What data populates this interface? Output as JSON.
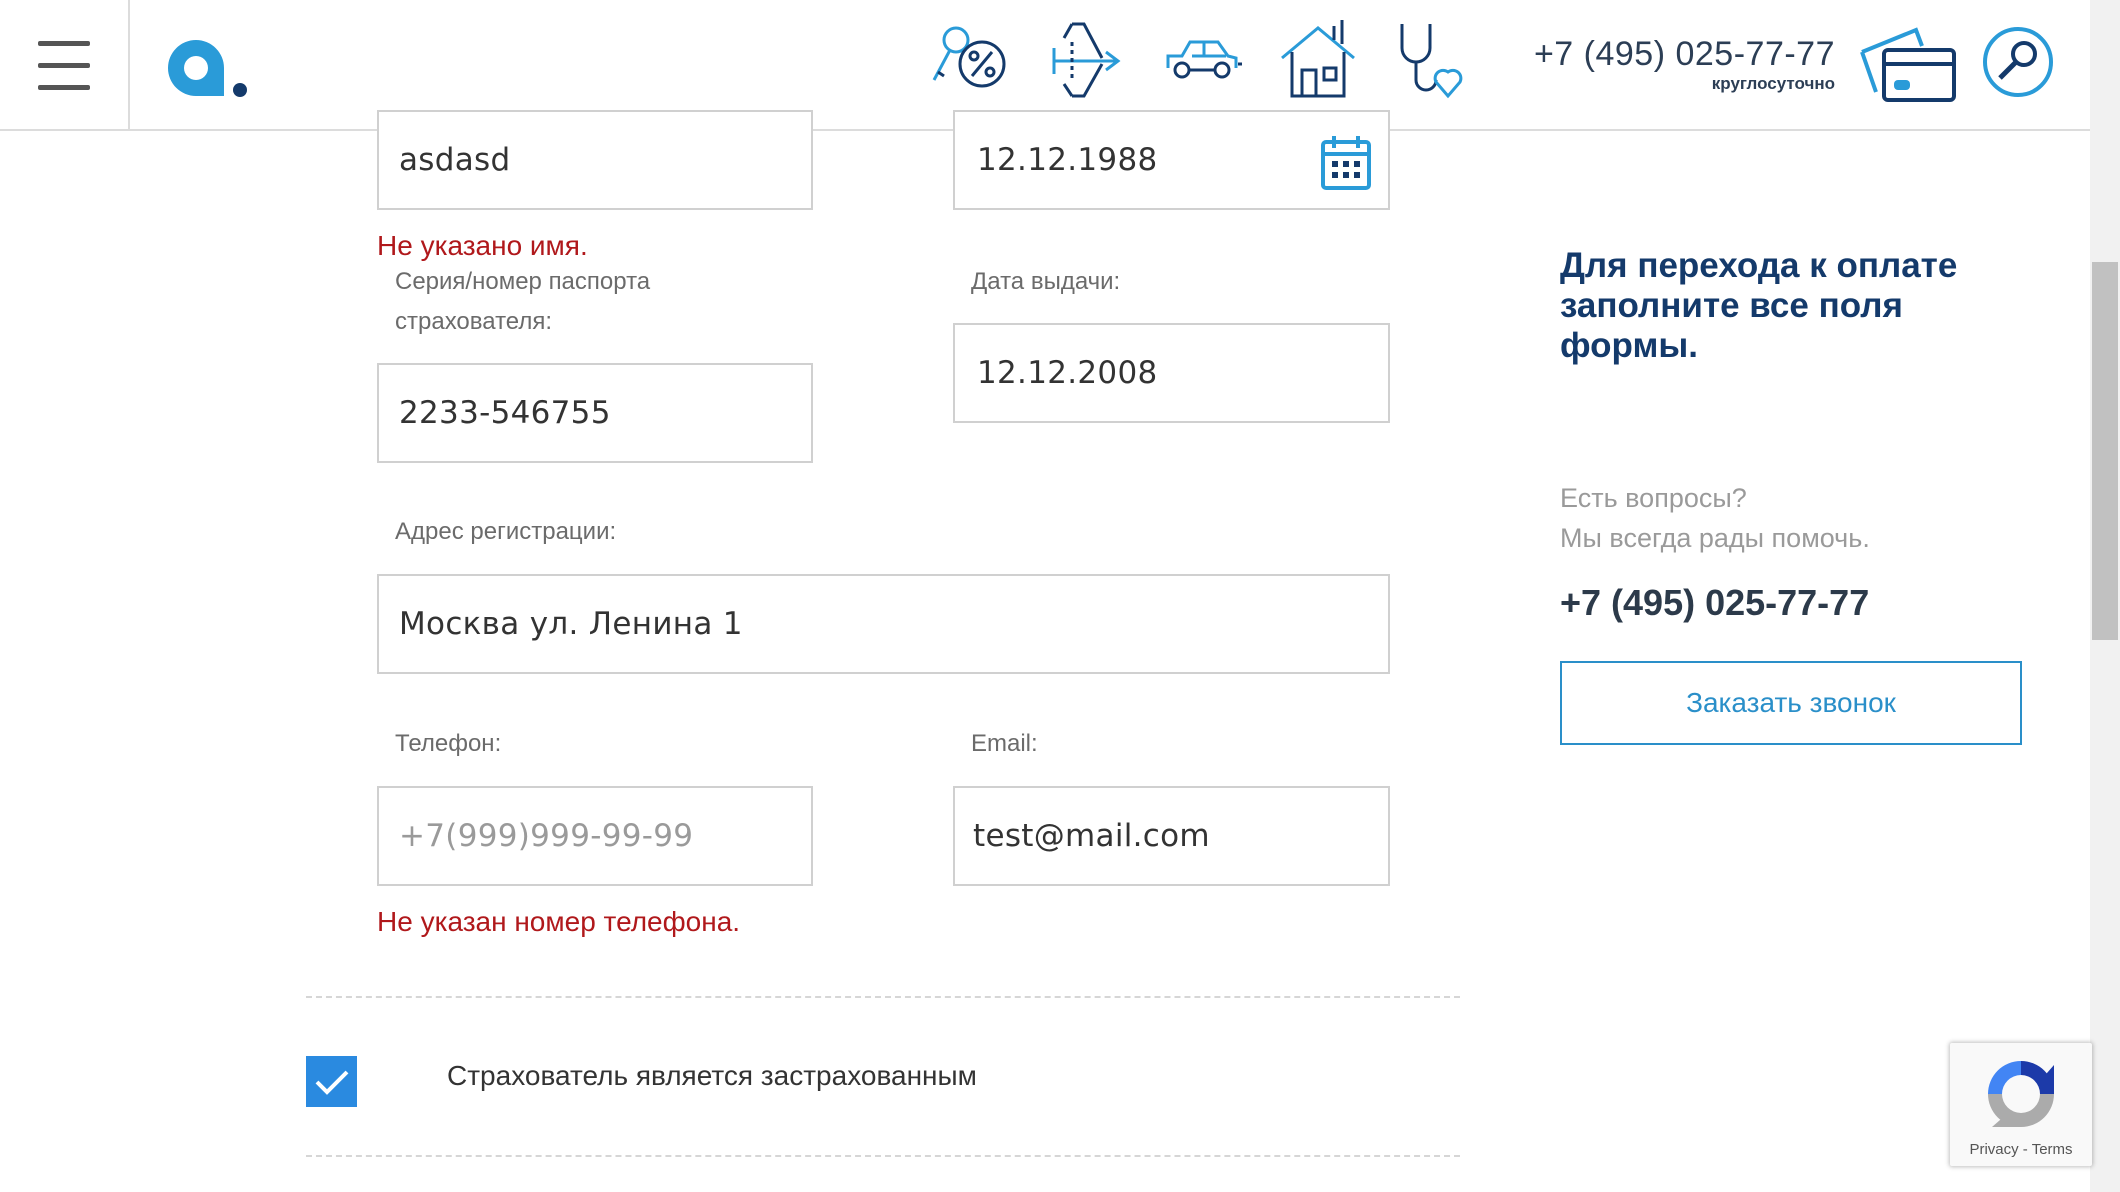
{
  "header": {
    "phone": "+7 (495) 025-77-77",
    "phone_note": "круглосуточно",
    "icons": [
      "key-percent-icon",
      "airplane-icon",
      "car-icon",
      "house-icon",
      "stethoscope-heart-icon",
      "payment-card-icon",
      "search-icon"
    ]
  },
  "form": {
    "name_value": "asdasd",
    "name_error": "Не указано имя.",
    "birth_date_value": "12.12.1988",
    "passport_label": "Серия/номер паспорта страхователя:",
    "passport_value": "2233-546755",
    "issue_date_label": "Дата выдачи:",
    "issue_date_value": "12.12.2008",
    "address_label": "Адрес регистрации:",
    "address_value": "Москва ул. Ленина 1",
    "phone_label": "Телефон:",
    "phone_placeholder": "+7(999)999-99-99",
    "phone_error": "Не указан номер телефона.",
    "email_label": "Email:",
    "email_value": "test@mail.com",
    "insured_checkbox_label": "Страхователь является застрахованным",
    "insured_checked": true
  },
  "sidebar": {
    "title": "Для перехода к оплате заполните все поля формы.",
    "question": "Есть вопросы?",
    "help": "Мы всегда рады помочь.",
    "phone": "+7 (495) 025-77-77",
    "call_button": "Заказать звонок"
  },
  "recaptcha": {
    "privacy": "Privacy",
    "separator": "-",
    "terms": "Terms"
  },
  "colors": {
    "accent_blue": "#2a8fc9",
    "dark_blue": "#143a6b",
    "error_red": "#b0181b",
    "checkbox_blue": "#2a8ae0"
  }
}
